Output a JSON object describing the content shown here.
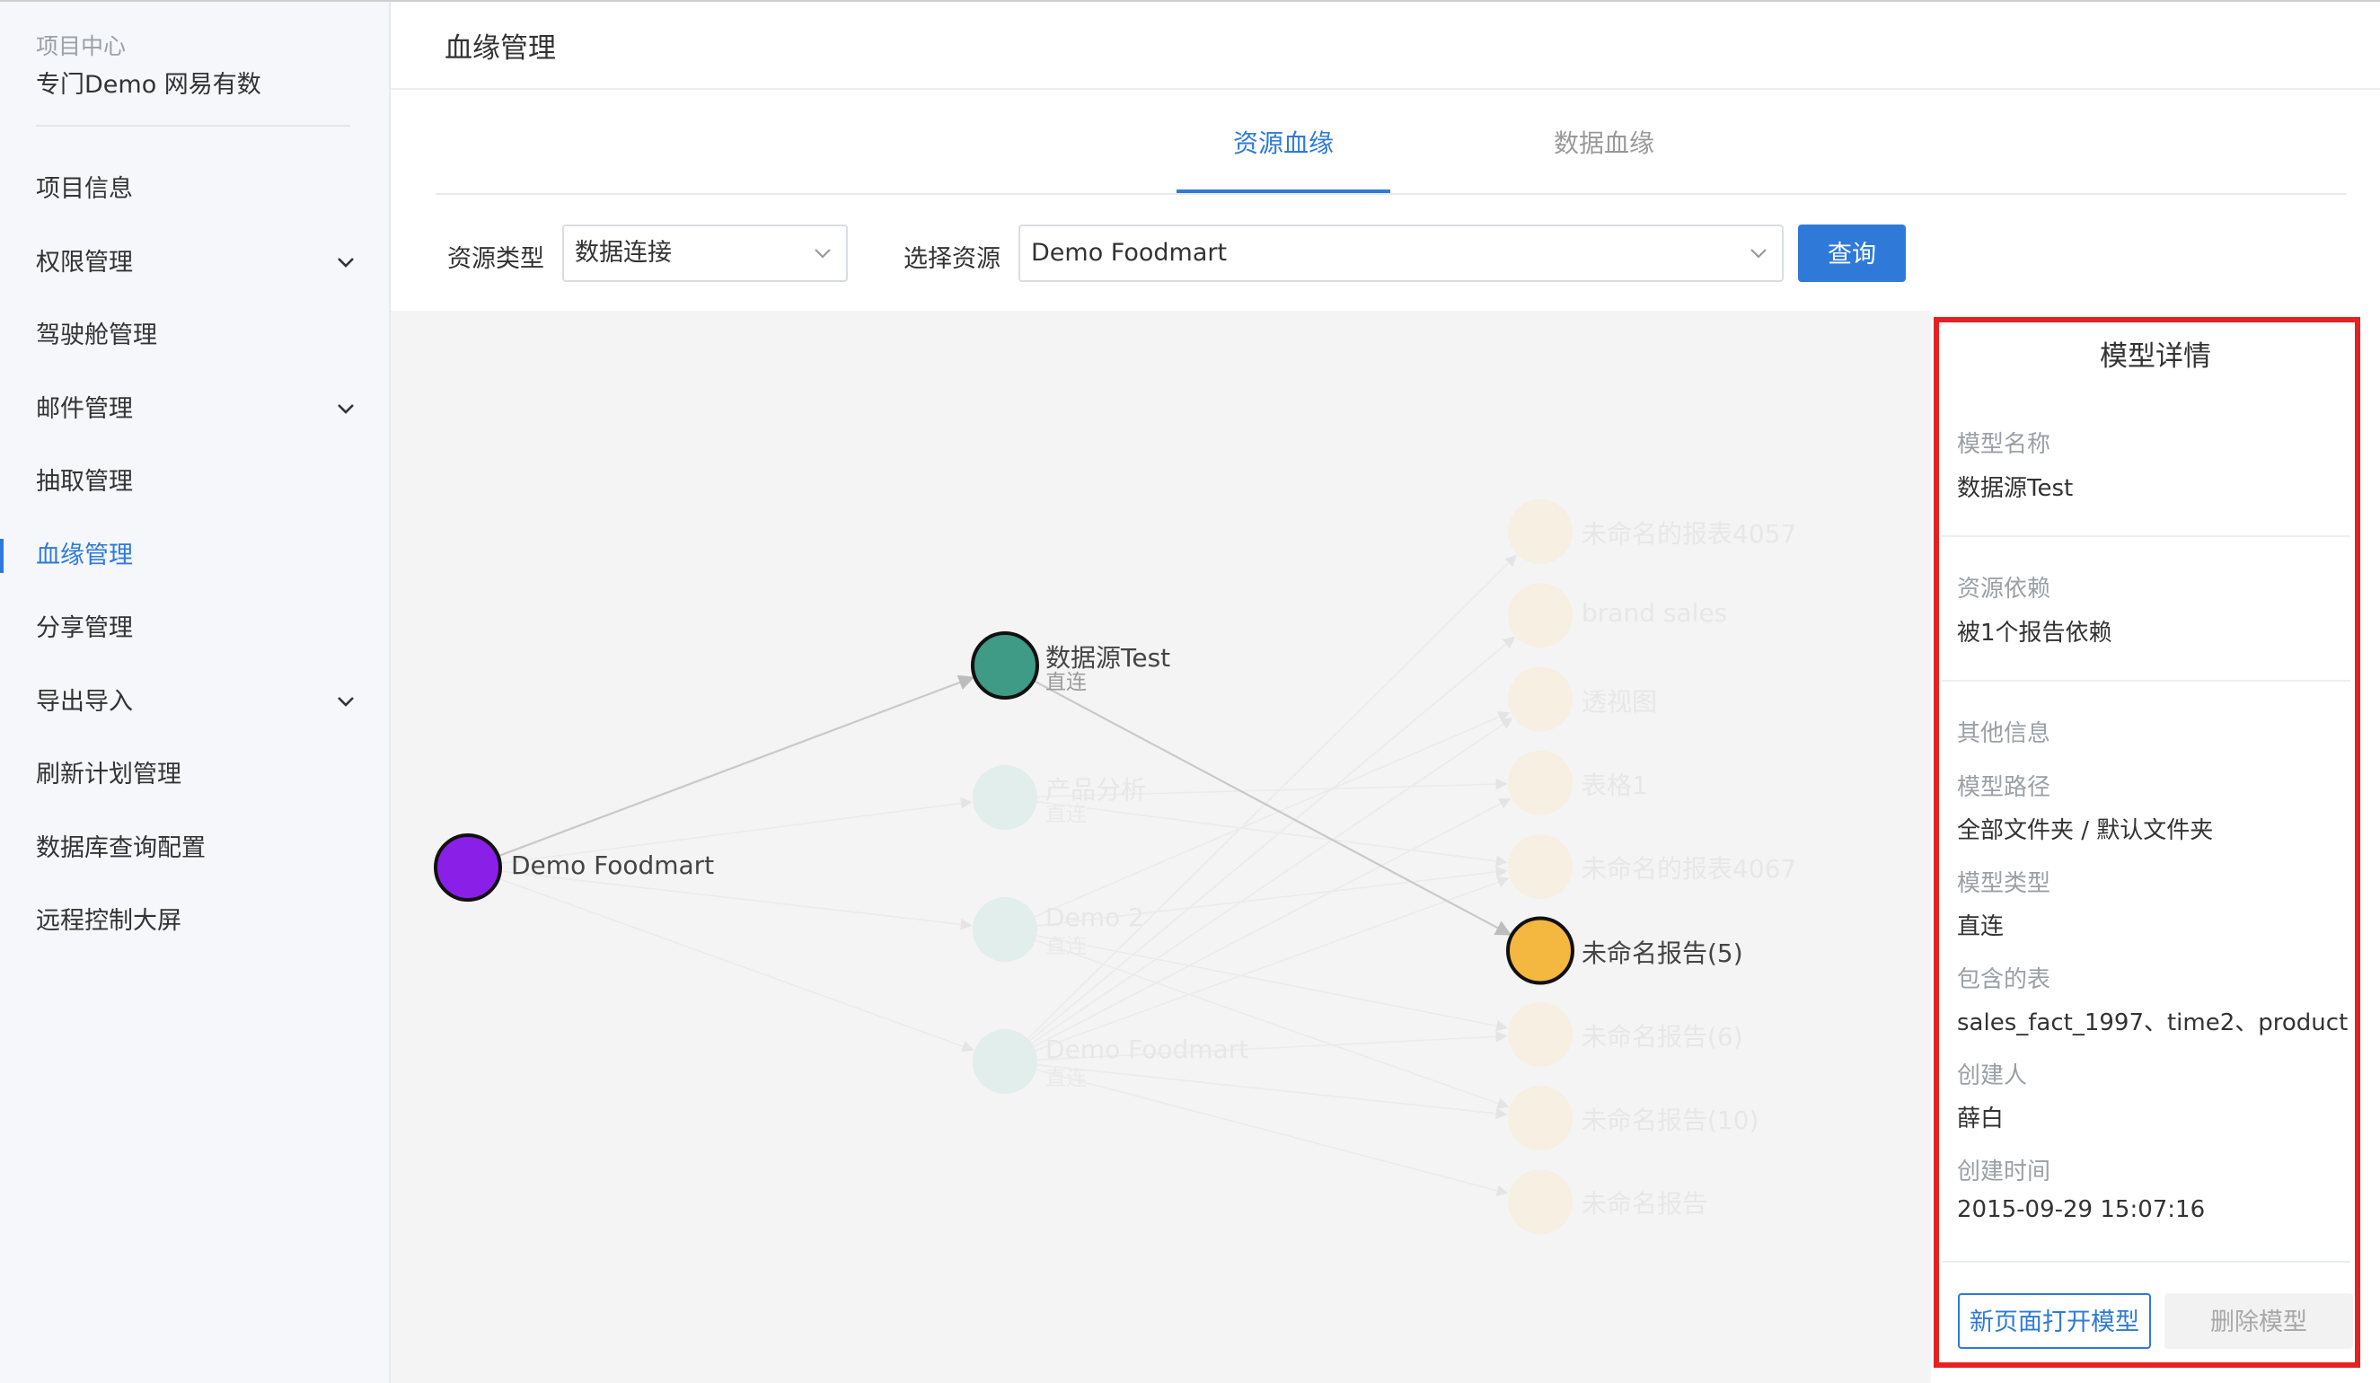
{
  "sidebar": {
    "project_caption": "项目中心",
    "project_name": "专门Demo 网易有数",
    "items": [
      {
        "label": "项目信息",
        "has_children": false,
        "active": false
      },
      {
        "label": "权限管理",
        "has_children": true,
        "active": false
      },
      {
        "label": "驾驶舱管理",
        "has_children": false,
        "active": false
      },
      {
        "label": "邮件管理",
        "has_children": true,
        "active": false
      },
      {
        "label": "抽取管理",
        "has_children": false,
        "active": false
      },
      {
        "label": "血缘管理",
        "has_children": false,
        "active": true
      },
      {
        "label": "分享管理",
        "has_children": false,
        "active": false
      },
      {
        "label": "导出导入",
        "has_children": true,
        "active": false
      },
      {
        "label": "刷新计划管理",
        "has_children": false,
        "active": false
      },
      {
        "label": "数据库查询配置",
        "has_children": false,
        "active": false
      },
      {
        "label": "远程控制大屏",
        "has_children": false,
        "active": false
      }
    ]
  },
  "header": {
    "title": "血缘管理"
  },
  "tabs": [
    {
      "label": "资源血缘",
      "active": true
    },
    {
      "label": "数据血缘",
      "active": false
    }
  ],
  "filters": {
    "resource_type_label": "资源类型",
    "resource_type_value": "数据连接",
    "select_resource_label": "选择资源",
    "select_resource_value": "Demo Foodmart",
    "query_button": "查询"
  },
  "graph": {
    "source": {
      "name": "Demo Foodmart",
      "color": "#8a1fe8"
    },
    "models": [
      {
        "name": "数据源Test",
        "sub": "直连",
        "highlight": true
      },
      {
        "name": "产品分析",
        "sub": "直连",
        "highlight": false
      },
      {
        "name": "Demo 2",
        "sub": "直连",
        "highlight": false
      },
      {
        "name": "Demo Foodmart",
        "sub": "直连",
        "highlight": false
      }
    ],
    "reports": [
      {
        "name": "未命名的报表4057",
        "highlight": false
      },
      {
        "name": "brand sales",
        "highlight": false
      },
      {
        "name": "透视图",
        "highlight": false
      },
      {
        "name": "表格1",
        "highlight": false
      },
      {
        "name": "未命名的报表4067",
        "highlight": false
      },
      {
        "name": "未命名报告(5)",
        "highlight": true
      },
      {
        "name": "未命名报告(6)",
        "highlight": false
      },
      {
        "name": "未命名报告(10)",
        "highlight": false
      },
      {
        "name": "未命名报告",
        "highlight": false
      }
    ],
    "colors": {
      "model": "#3f9a86",
      "model_faint": "#e1eeeb",
      "report": "#f4b73f",
      "report_faint": "#f6efe2",
      "edge": "#cfcfcf",
      "edge_faint": "#eaeaea"
    }
  },
  "details": {
    "title": "模型详情",
    "model_name_label": "模型名称",
    "model_name": "数据源Test",
    "dependency_label": "资源依赖",
    "dependency": "被1个报告依赖",
    "other_label": "其他信息",
    "path_label": "模型路径",
    "path": "全部文件夹 / 默认文件夹",
    "type_label": "模型类型",
    "type": "直连",
    "tables_label": "包含的表",
    "tables": "sales_fact_1997、time2、product",
    "creator_label": "创建人",
    "creator": "薛白",
    "created_label": "创建时间",
    "created": "2015-09-29 15:07:16",
    "open_button": "新页面打开模型",
    "delete_button": "删除模型"
  },
  "accent_color": "#2f7ad9",
  "highlight_border_color": "#e52222"
}
